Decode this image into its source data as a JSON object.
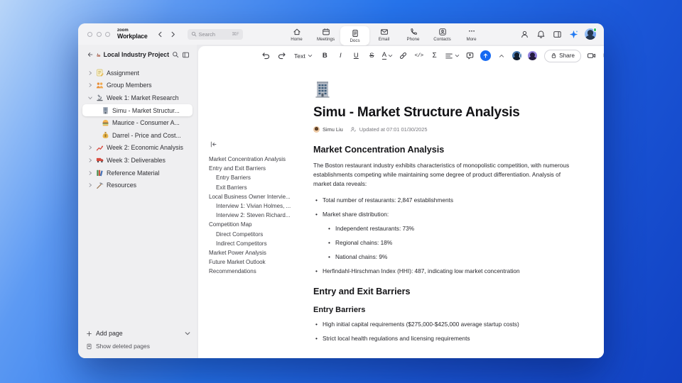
{
  "titlebar": {
    "logo_line1": "zoom",
    "logo_line2": "Workplace",
    "search_placeholder": "Search",
    "search_shortcut": "⌘F",
    "tabs": [
      "Home",
      "Meetings",
      "Docs",
      "Email",
      "Phone",
      "Contacts",
      "More"
    ]
  },
  "sidebar": {
    "project_title": "Local Industry Project",
    "items": [
      {
        "label": "Assignment",
        "icon": "memo-icon"
      },
      {
        "label": "Group Members",
        "icon": "group-icon"
      },
      {
        "label": "Week 1: Market Research",
        "icon": "microscope-icon"
      },
      {
        "label": "Simu - Market Structur...",
        "icon": "office-building-icon"
      },
      {
        "label": "Maurice - Consumer A...",
        "icon": "burger-icon"
      },
      {
        "label": "Darrel - Price and Cost...",
        "icon": "money-bag-icon"
      },
      {
        "label": "Week 2: Economic Analysis",
        "icon": "chart-up-icon"
      },
      {
        "label": "Week 3: Deliverables",
        "icon": "truck-icon"
      },
      {
        "label": "Reference Material",
        "icon": "books-icon"
      },
      {
        "label": "Resources",
        "icon": "pick-icon"
      }
    ],
    "add_page_label": "Add page",
    "show_deleted_label": "Show deleted pages"
  },
  "toolbar": {
    "text_style_label": "Text",
    "bold_label": "B",
    "italic_label": "I",
    "underline_label": "U",
    "strike_label": "S",
    "color_label": "A",
    "code_label": "</>",
    "sigma_label": "Σ",
    "share_label": "Share"
  },
  "outline": {
    "items": [
      "Market Concentration Analysis",
      "Entry and Exit Barriers",
      "Entry Barriers",
      "Exit Barriers",
      "Local Business Owner Intervie...",
      "Interview 1: Vivian Holmes, ...",
      "Interview 2: Steven Richard...",
      "Competition Map",
      "Direct Competitors",
      "Indirect Competitors",
      "Market Power Analysis",
      "Future Market Outlook",
      "Recommendations"
    ]
  },
  "doc": {
    "title": "Simu - Market Structure Analysis",
    "author": "Simu Liu",
    "updated": "Updated at 07:01 01/30/2025",
    "section1": {
      "heading": "Market Concentration Analysis",
      "intro": "The Boston restaurant industry exhibits characteristics of monopolistic competition, with numerous establishments competing while maintaining some degree of product differentiation. Analysis of market data reveals:",
      "bullets": [
        "Total number of restaurants: 2,847 establishments",
        "Market share distribution:",
        "Independent restaurants: 73%",
        "Regional chains: 18%",
        "National chains: 9%",
        "Herfindahl-Hirschman Index (HHI): 487, indicating low market concentration"
      ]
    },
    "section2": {
      "heading": "Entry and Exit Barriers",
      "subheading": "Entry Barriers",
      "bullets": [
        "High initial capital requirements ($275,000-$425,000 average startup costs)",
        "Strict local health regulations and licensing requirements"
      ]
    }
  },
  "colors": {
    "accent_blue": "#166af2"
  }
}
